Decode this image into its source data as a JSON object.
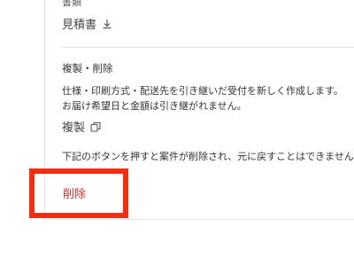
{
  "documents": {
    "heading": "書類",
    "estimate_label": "見積書",
    "download_icon": "download-icon"
  },
  "duplicate_delete": {
    "title": "複製・削除",
    "description_line1": "仕様・印刷方式・配送先を引き継いだ受付を新しく作成します。",
    "description_line2": "お届け希望日と金額は引き継がれません。",
    "duplicate_label": "複製",
    "copy_icon": "copy-icon",
    "delete_note": "下記のボタンを押すと案件が削除され、元に戻すことはできません。",
    "delete_label": "削除"
  },
  "colors": {
    "delete_text": "#d32f2f",
    "highlight_border": "#ff2a0a"
  }
}
